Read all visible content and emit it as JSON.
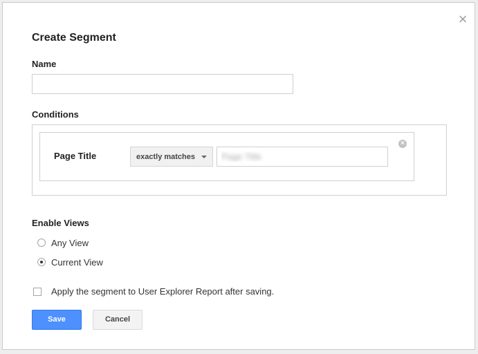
{
  "dialog": {
    "title": "Create Segment",
    "close_icon": "close-icon"
  },
  "name": {
    "label": "Name",
    "value": "",
    "placeholder": ""
  },
  "conditions": {
    "label": "Conditions",
    "rows": [
      {
        "dimension": "Page Title",
        "operator": "exactly matches",
        "value": "Page Title"
      }
    ]
  },
  "views": {
    "label": "Enable Views",
    "options": [
      {
        "label": "Any View",
        "checked": false
      },
      {
        "label": "Current View",
        "checked": true
      }
    ]
  },
  "apply_checkbox": {
    "label": "Apply the segment to User Explorer Report after saving.",
    "checked": false
  },
  "buttons": {
    "save": "Save",
    "cancel": "Cancel"
  },
  "colors": {
    "primary": "#4d90fe",
    "border": "#cfcfcf"
  }
}
